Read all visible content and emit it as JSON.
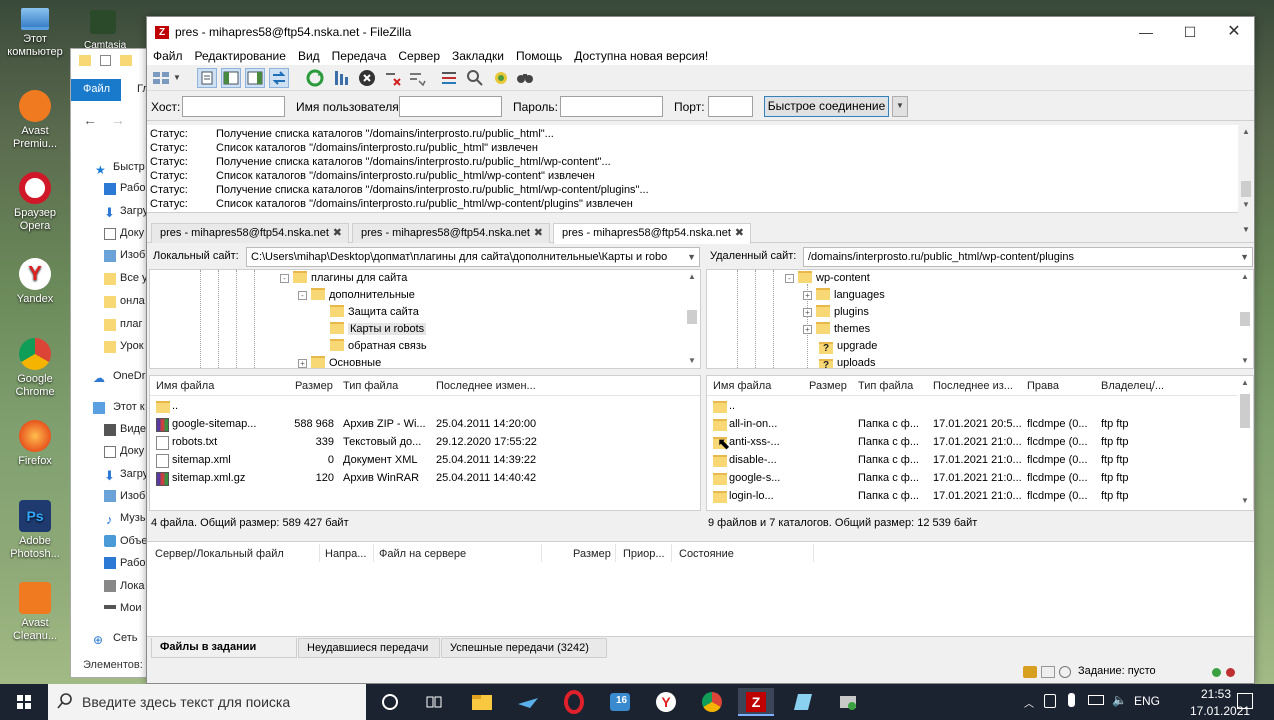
{
  "desktop": {
    "icons": [
      {
        "label": "Этот компьютер",
        "color": "#5aa0e0"
      },
      {
        "label": "Avast Premiu...",
        "color": "#f07a20"
      },
      {
        "label": "Браузер Opera",
        "color": "#d01828"
      },
      {
        "label": "Yandex",
        "color": "#ffffff"
      },
      {
        "label": "Google Chrome",
        "color": "#3aa757"
      },
      {
        "label": "Firefox",
        "color": "#e86a20"
      },
      {
        "label": "Adobe Photosh...",
        "color": "#1f3a6e"
      },
      {
        "label": "Avast Cleanu...",
        "color": "#f07a20"
      }
    ],
    "top_icon_label": "Camtasia"
  },
  "explorer": {
    "file_tab": "Файл",
    "ribbon_partial": "Гл",
    "nav": [
      {
        "label": "Быстр"
      },
      {
        "label": "Рабо"
      },
      {
        "label": "Загру"
      },
      {
        "label": "Доку"
      },
      {
        "label": "Изоб"
      },
      {
        "label": "Все у"
      },
      {
        "label": "онла"
      },
      {
        "label": "плаг"
      },
      {
        "label": "Урок"
      },
      {
        "label": "OneDr"
      },
      {
        "label": "Этот к"
      },
      {
        "label": "Виде"
      },
      {
        "label": "Доку"
      },
      {
        "label": "Загру"
      },
      {
        "label": "Изоб"
      },
      {
        "label": "Музы"
      },
      {
        "label": "Объе"
      },
      {
        "label": "Рабо"
      },
      {
        "label": "Лока"
      },
      {
        "label": "Мои"
      },
      {
        "label": "Сеть"
      }
    ],
    "status": "Элементов:"
  },
  "window": {
    "title": "pres - mihapres58@ftp54.nska.net - FileZilla",
    "app_glyph": "Z"
  },
  "menu": [
    "Файл",
    "Редактирование",
    "Вид",
    "Передача",
    "Сервер",
    "Закладки",
    "Помощь",
    "Доступна новая версия!"
  ],
  "quickconnect": {
    "host_label": "Хост:",
    "user_label": "Имя пользователя:",
    "pass_label": "Пароль:",
    "port_label": "Порт:",
    "host_value": "",
    "user_value": "",
    "pass_value": "",
    "port_value": "",
    "button": "Быстрое соединение"
  },
  "log": [
    {
      "key": "Статус:",
      "msg": "Получение списка каталогов \"/domains/interprosto.ru/public_html\"..."
    },
    {
      "key": "Статус:",
      "msg": "Список каталогов \"/domains/interprosto.ru/public_html\" извлечен"
    },
    {
      "key": "Статус:",
      "msg": "Получение списка каталогов \"/domains/interprosto.ru/public_html/wp-content\"..."
    },
    {
      "key": "Статус:",
      "msg": "Список каталогов \"/domains/interprosto.ru/public_html/wp-content\" извлечен"
    },
    {
      "key": "Статус:",
      "msg": "Получение списка каталогов \"/domains/interprosto.ru/public_html/wp-content/plugins\"..."
    },
    {
      "key": "Статус:",
      "msg": "Список каталогов \"/domains/interprosto.ru/public_html/wp-content/plugins\" извлечен"
    }
  ],
  "tabs": [
    {
      "label": "pres - mihapres58@ftp54.nska.net",
      "active": false
    },
    {
      "label": "pres - mihapres58@ftp54.nska.net",
      "active": false
    },
    {
      "label": "pres - mihapres58@ftp54.nska.net",
      "active": true
    }
  ],
  "local": {
    "label": "Локальный сайт:",
    "path": "C:\\Users\\mihap\\Desktop\\допмат\\плагины для сайта\\дополнительные\\Карты и robo",
    "tree": [
      {
        "label": "плагины для сайта",
        "expander": "-"
      },
      {
        "label": "дополнительные",
        "expander": "-"
      },
      {
        "label": "Защита сайта",
        "expander": ""
      },
      {
        "label": "Карты и robots",
        "expander": "",
        "selected": true
      },
      {
        "label": "обратная связь",
        "expander": ""
      },
      {
        "label": "Основные",
        "expander": "+"
      }
    ],
    "columns": [
      "Имя файла",
      "Размер",
      "Тип файла",
      "Последнее измен..."
    ],
    "files": [
      {
        "name": "..",
        "size": "",
        "type": "",
        "modified": "",
        "icon": "fold"
      },
      {
        "name": "google-sitemap...",
        "size": "588 968",
        "type": "Архив ZIP - Wi...",
        "modified": "25.04.2011 14:20:00",
        "icon": "zip"
      },
      {
        "name": "robots.txt",
        "size": "339",
        "type": "Текстовый до...",
        "modified": "29.12.2020 17:55:22",
        "icon": "doc"
      },
      {
        "name": "sitemap.xml",
        "size": "0",
        "type": "Документ XML",
        "modified": "25.04.2011 14:39:22",
        "icon": "doc"
      },
      {
        "name": "sitemap.xml.gz",
        "size": "120",
        "type": "Архив WinRAR",
        "modified": "25.04.2011 14:40:42",
        "icon": "zip"
      }
    ],
    "status": "4 файла. Общий размер: 589 427 байт"
  },
  "remote": {
    "label": "Удаленный сайт:",
    "path": "/domains/interprosto.ru/public_html/wp-content/plugins",
    "tree": [
      {
        "label": "wp-content",
        "expander": "-"
      },
      {
        "label": "languages",
        "expander": "+"
      },
      {
        "label": "plugins",
        "expander": "+"
      },
      {
        "label": "themes",
        "expander": "+"
      },
      {
        "label": "upgrade",
        "expander": "",
        "q": true
      },
      {
        "label": "uploads",
        "expander": "",
        "q": true
      }
    ],
    "columns": [
      "Имя файла",
      "Размер",
      "Тип файла",
      "Последнее из...",
      "Права",
      "Владелец/..."
    ],
    "files": [
      {
        "name": "..",
        "size": "",
        "type": "",
        "modified": "",
        "perms": "",
        "owner": ""
      },
      {
        "name": "all-in-on...",
        "size": "",
        "type": "Папка с ф...",
        "modified": "17.01.2021 20:5...",
        "perms": "flcdmpe (0...",
        "owner": "ftp ftp"
      },
      {
        "name": "anti-xss-...",
        "size": "",
        "type": "Папка с ф...",
        "modified": "17.01.2021 21:0...",
        "perms": "flcdmpe (0...",
        "owner": "ftp ftp"
      },
      {
        "name": "disable-...",
        "size": "",
        "type": "Папка с ф...",
        "modified": "17.01.2021 21:0...",
        "perms": "flcdmpe (0...",
        "owner": "ftp ftp"
      },
      {
        "name": "google-s...",
        "size": "",
        "type": "Папка с ф...",
        "modified": "17.01.2021 21:0...",
        "perms": "flcdmpe (0...",
        "owner": "ftp ftp"
      },
      {
        "name": "login-lo...",
        "size": "",
        "type": "Папка с ф...",
        "modified": "17.01.2021 21:0...",
        "perms": "flcdmpe (0...",
        "owner": "ftp ftp"
      }
    ],
    "status": "9 файлов и 7 каталогов. Общий размер: 12 539 байт"
  },
  "queue": {
    "columns": [
      "Сервер/Локальный файл",
      "Напра...",
      "Файл на сервере",
      "Размер",
      "Приор...",
      "Состояние"
    ]
  },
  "bottom_tabs": [
    {
      "label": "Файлы в задании",
      "active": true
    },
    {
      "label": "Неудавшиеся передачи",
      "active": false
    },
    {
      "label": "Успешные передачи (3242)",
      "active": false
    }
  ],
  "statusbar": {
    "queue": "Задание: пусто"
  },
  "taskbar": {
    "search_placeholder": "Введите здесь текст для поиска",
    "lang": "ENG",
    "time": "21:53",
    "date": "17.01.2021",
    "app_badge": "16"
  }
}
